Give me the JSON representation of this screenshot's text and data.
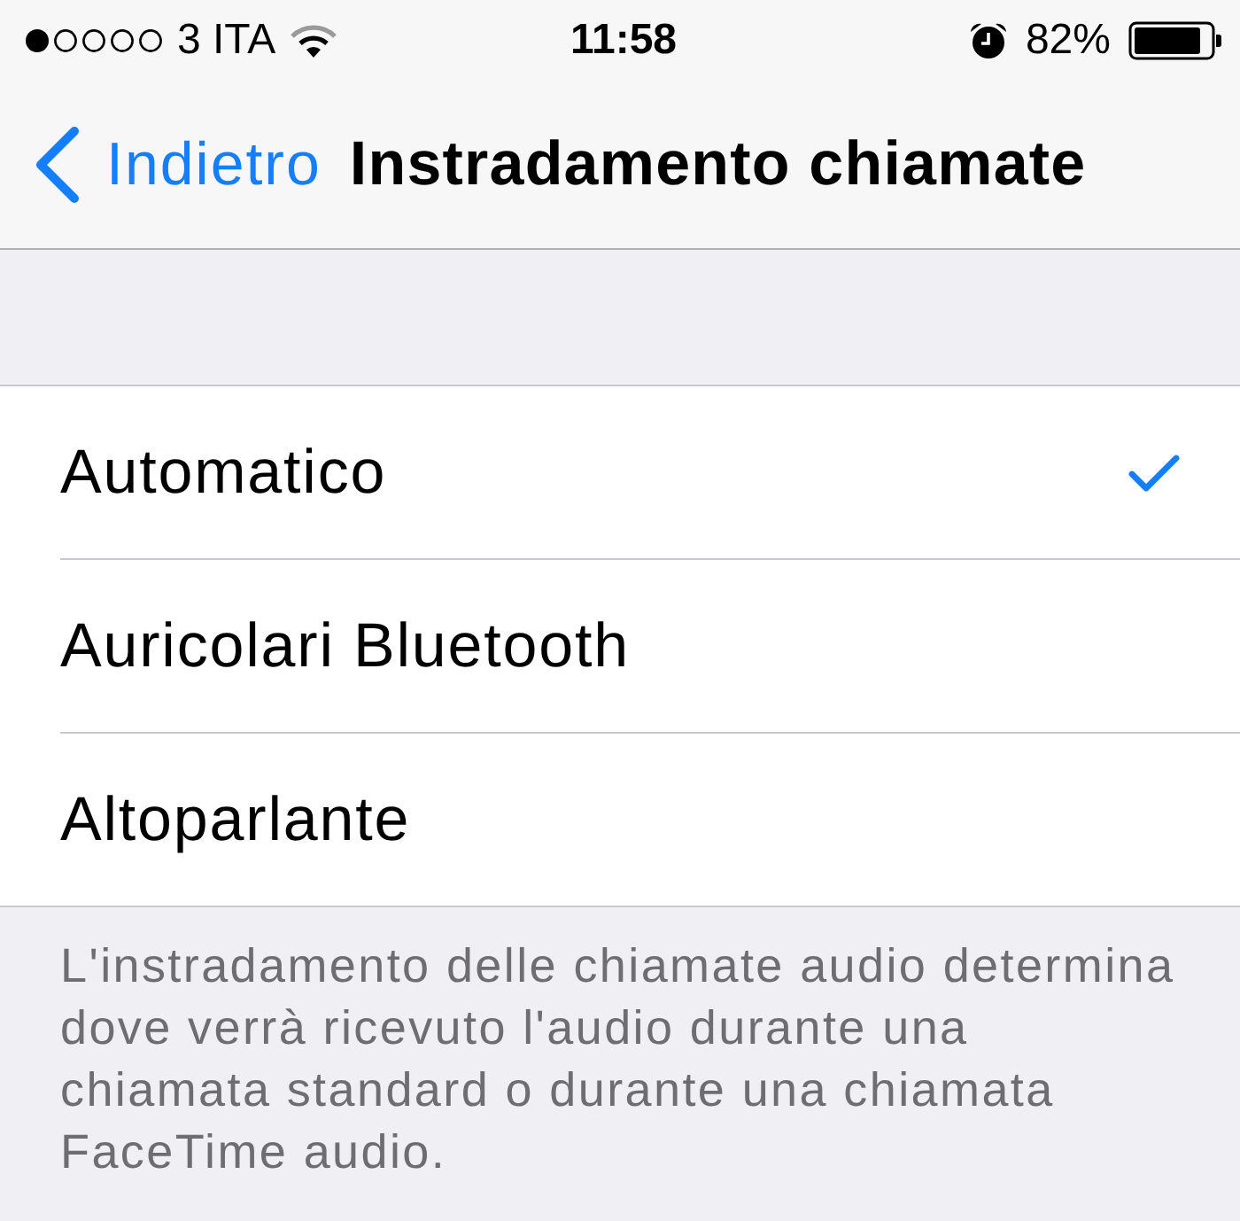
{
  "status_bar": {
    "carrier": "3 ITA",
    "time": "11:58",
    "battery": "82%"
  },
  "nav_bar": {
    "back": "Indietro",
    "title": "Instradamento chiamate"
  },
  "options": [
    {
      "label": "Automatico",
      "selected": true
    },
    {
      "label": "Auricolari Bluetooth",
      "selected": false
    },
    {
      "label": "Altoparlante",
      "selected": false
    }
  ],
  "footer": "L'instradamento delle chiamate audio determina dove verrà ricevuto l'audio durante una chiamata standard o durante una chiamata FaceTime audio."
}
